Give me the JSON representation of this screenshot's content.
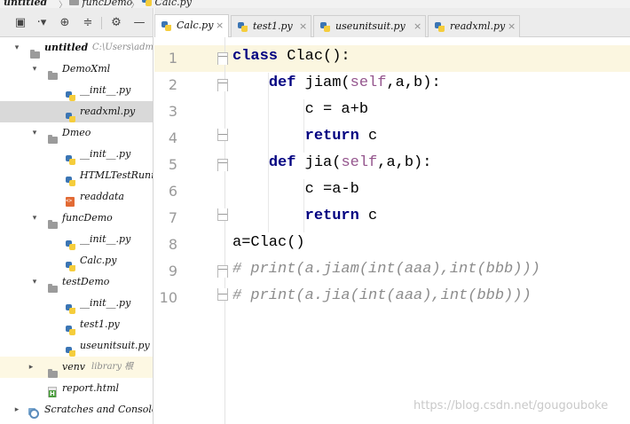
{
  "breadcrumb": {
    "items": [
      "untitled",
      "funcDemo",
      "Calc.py"
    ]
  },
  "project_panel": {
    "toolbar": {
      "layout_icon": "window-layout-icon",
      "collapse_icon": "collapse-dropdown-icon",
      "locate_icon": "crosshair-icon",
      "scroll_icon": "collapse-all-icon",
      "settings_icon": "gear-icon",
      "hide_label": "—"
    },
    "tree": [
      {
        "label": "untitled",
        "hint": "C:\\Users\\adm",
        "icon": "folder-icon",
        "arrow": "▾"
      },
      {
        "label": "DemoXml",
        "icon": "folder-icon",
        "arrow": "▾"
      },
      {
        "label": "__init__.py",
        "icon": "python-file-icon"
      },
      {
        "label": "readxml.py",
        "icon": "python-file-icon"
      },
      {
        "label": "Dmeo",
        "icon": "folder-icon",
        "arrow": "▾"
      },
      {
        "label": "__init__.py",
        "icon": "python-file-icon"
      },
      {
        "label": "HTMLTestRunn",
        "icon": "python-file-icon"
      },
      {
        "label": "readdata",
        "icon": "xml-file-icon"
      },
      {
        "label": "funcDemo",
        "icon": "folder-icon",
        "arrow": "▾"
      },
      {
        "label": "__init__.py",
        "icon": "python-file-icon"
      },
      {
        "label": "Calc.py",
        "icon": "python-file-icon"
      },
      {
        "label": "testDemo",
        "icon": "folder-icon",
        "arrow": "▾"
      },
      {
        "label": "__init__.py",
        "icon": "python-file-icon"
      },
      {
        "label": "test1.py",
        "icon": "python-file-icon"
      },
      {
        "label": "useunitsuit.py",
        "icon": "python-file-icon"
      },
      {
        "label": "venv",
        "hint": "library 根",
        "icon": "folder-icon",
        "arrow": "▸"
      },
      {
        "label": "report.html",
        "icon": "html-file-icon"
      },
      {
        "label": "Scratches and Console",
        "icon": "scratches-icon"
      }
    ]
  },
  "tabs": [
    {
      "label": "Calc.py",
      "close": "×"
    },
    {
      "label": "test1.py",
      "close": "×"
    },
    {
      "label": "useunitsuit.py",
      "close": "×"
    },
    {
      "label": "readxml.py",
      "close": "×"
    }
  ],
  "editor": {
    "line_numbers": [
      "1",
      "2",
      "3",
      "4",
      "5",
      "6",
      "7",
      "8",
      "9",
      "10"
    ],
    "lines": [
      [
        {
          "t": "class ",
          "c": "kw"
        },
        {
          "t": "Clac():",
          "c": ""
        }
      ],
      [
        {
          "t": "    ",
          "c": ""
        },
        {
          "t": "def ",
          "c": "kw"
        },
        {
          "t": "jiam(",
          "c": ""
        },
        {
          "t": "self",
          "c": "selfkw"
        },
        {
          "t": ",a,b):",
          "c": ""
        }
      ],
      [
        {
          "t": "        c = a+b",
          "c": ""
        }
      ],
      [
        {
          "t": "        ",
          "c": ""
        },
        {
          "t": "return ",
          "c": "kw"
        },
        {
          "t": "c",
          "c": ""
        }
      ],
      [
        {
          "t": "    ",
          "c": ""
        },
        {
          "t": "def ",
          "c": "kw"
        },
        {
          "t": "jia(",
          "c": ""
        },
        {
          "t": "self",
          "c": "selfkw"
        },
        {
          "t": ",a,b):",
          "c": ""
        }
      ],
      [
        {
          "t": "        c =a-b",
          "c": ""
        }
      ],
      [
        {
          "t": "        ",
          "c": ""
        },
        {
          "t": "return ",
          "c": "kw"
        },
        {
          "t": "c",
          "c": ""
        }
      ],
      [
        {
          "t": "a=Clac()",
          "c": ""
        }
      ],
      [
        {
          "t": "# print(a.jiam(int(aaa),int(bbb)))",
          "c": "cm"
        }
      ],
      [
        {
          "t": "# print(a.jia(int(aaa),int(bbb)))",
          "c": "cm"
        }
      ]
    ]
  },
  "watermark": "https://blog.csdn.net/gougouboke",
  "colors": {
    "keyword": "#000080",
    "self": "#94558d",
    "comment": "#8c8c8c",
    "current_line": "#fbf6e0",
    "selected_row": "#d9d9d9"
  }
}
